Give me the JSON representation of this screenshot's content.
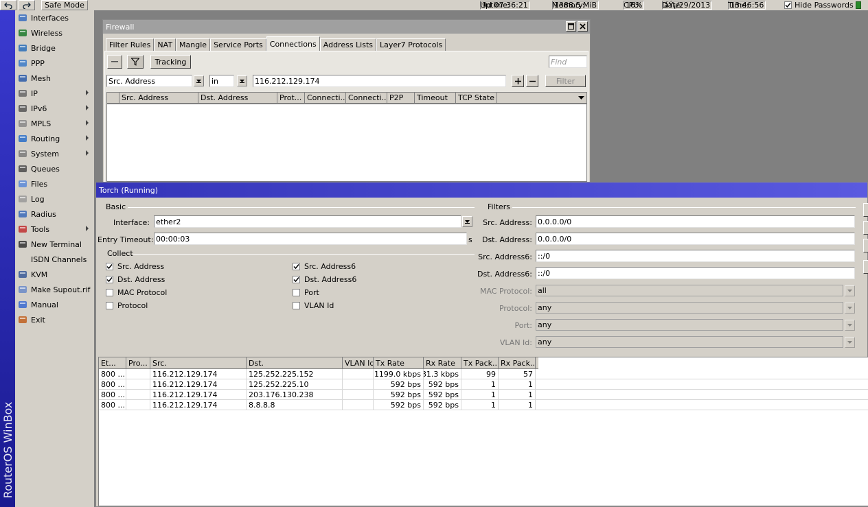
{
  "topbar": {
    "safe_mode": "Safe Mode",
    "uptime_label": "Uptime:",
    "uptime": "9d 07:36:21",
    "memory_label": "Memory:",
    "memory": "1388.5 MiB",
    "cpu_label": "CPU:",
    "cpu": "16%",
    "date_label": "Date:",
    "date": "áÝ¡/29/2013",
    "time_label": "Time:",
    "time": "13:46:56",
    "hide_passwords": "Hide Passwords"
  },
  "brand": "RouterOS WinBox",
  "menu": [
    {
      "label": "Interfaces",
      "icon": "interfaces-icon",
      "sub": false
    },
    {
      "label": "Wireless",
      "icon": "wireless-icon",
      "sub": false
    },
    {
      "label": "Bridge",
      "icon": "bridge-icon",
      "sub": false
    },
    {
      "label": "PPP",
      "icon": "ppp-icon",
      "sub": false
    },
    {
      "label": "Mesh",
      "icon": "mesh-icon",
      "sub": false
    },
    {
      "label": "IP",
      "icon": "ip-icon",
      "sub": true
    },
    {
      "label": "IPv6",
      "icon": "ipv6-icon",
      "sub": true
    },
    {
      "label": "MPLS",
      "icon": "mpls-icon",
      "sub": true
    },
    {
      "label": "Routing",
      "icon": "routing-icon",
      "sub": true
    },
    {
      "label": "System",
      "icon": "system-icon",
      "sub": true
    },
    {
      "label": "Queues",
      "icon": "queues-icon",
      "sub": false
    },
    {
      "label": "Files",
      "icon": "files-icon",
      "sub": false
    },
    {
      "label": "Log",
      "icon": "log-icon",
      "sub": false
    },
    {
      "label": "Radius",
      "icon": "radius-icon",
      "sub": false
    },
    {
      "label": "Tools",
      "icon": "tools-icon",
      "sub": true
    },
    {
      "label": "New Terminal",
      "icon": "terminal-icon",
      "sub": false
    },
    {
      "label": "ISDN Channels",
      "icon": "",
      "sub": false
    },
    {
      "label": "KVM",
      "icon": "kvm-icon",
      "sub": false
    },
    {
      "label": "Make Supout.rif",
      "icon": "supout-icon",
      "sub": false
    },
    {
      "label": "Manual",
      "icon": "manual-icon",
      "sub": false
    },
    {
      "label": "Exit",
      "icon": "exit-icon",
      "sub": false
    }
  ],
  "firewall": {
    "title": "Firewall",
    "tabs": [
      "Filter Rules",
      "NAT",
      "Mangle",
      "Service Ports",
      "Connections",
      "Address Lists",
      "Layer7 Protocols"
    ],
    "active_tab": "Connections",
    "tracking": "Tracking",
    "find_placeholder": "Find",
    "filter_field": "Src. Address",
    "filter_op": "in",
    "filter_value": "116.212.129.174",
    "filter_button": "Filter",
    "columns": [
      "Src. Address",
      "Dst. Address",
      "Prot...",
      "Connecti...",
      "Connecti...",
      "P2P",
      "Timeout",
      "TCP State"
    ]
  },
  "torch": {
    "title": "Torch (Running)",
    "basic": "Basic",
    "interface_label": "Interface:",
    "interface": "ether2",
    "entry_timeout_label": "Entry Timeout:",
    "entry_timeout": "00:00:03",
    "entry_timeout_unit": "s",
    "collect": "Collect",
    "checkboxes": [
      {
        "label": "Src. Address",
        "checked": true
      },
      {
        "label": "Dst. Address",
        "checked": true
      },
      {
        "label": "MAC Protocol",
        "checked": false
      },
      {
        "label": "Protocol",
        "checked": false
      },
      {
        "label": "Src. Address6",
        "checked": true
      },
      {
        "label": "Dst. Address6",
        "checked": true
      },
      {
        "label": "Port",
        "checked": false
      },
      {
        "label": "VLAN Id",
        "checked": false
      }
    ],
    "filters": "Filters",
    "src_address_label": "Src. Address:",
    "src_address": "0.0.0.0/0",
    "dst_address_label": "Dst. Address:",
    "dst_address": "0.0.0.0/0",
    "src_address6_label": "Src. Address6:",
    "src_address6": "::/0",
    "dst_address6_label": "Dst. Address6:",
    "dst_address6": "::/0",
    "mac_protocol_label": "MAC Protocol:",
    "mac_protocol": "all",
    "protocol_label": "Protocol:",
    "protocol": "any",
    "port_label": "Port:",
    "port": "any",
    "vlan_label": "VLAN Id:",
    "vlan": "any",
    "columns": [
      "Et...",
      "Pro...",
      "Src.",
      "Dst.",
      "VLAN Id",
      "Tx Rate",
      "Rx Rate",
      "Tx Pack...",
      "Rx Pack..."
    ],
    "rows": [
      [
        "800 ...",
        "",
        "116.212.129.174",
        "125.252.225.152",
        "",
        "1199.0 kbps",
        "31.3 kbps",
        "99",
        "57"
      ],
      [
        "800 ...",
        "",
        "116.212.129.174",
        "125.252.225.10",
        "",
        "592 bps",
        "592 bps",
        "1",
        "1"
      ],
      [
        "800 ...",
        "",
        "116.212.129.174",
        "203.176.130.238",
        "",
        "592 bps",
        "592 bps",
        "1",
        "1"
      ],
      [
        "800 ...",
        "",
        "116.212.129.174",
        "8.8.8.8",
        "",
        "592 bps",
        "592 bps",
        "1",
        "1"
      ]
    ]
  }
}
